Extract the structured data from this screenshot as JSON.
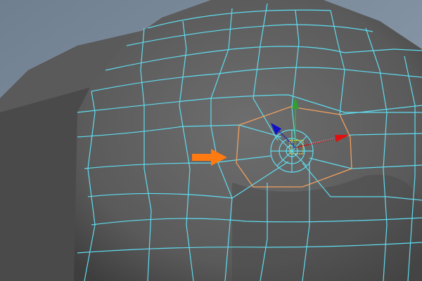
{
  "viewport": {
    "background_color": "#7c8c9c",
    "mesh_color": "#5fdcf0",
    "selection_color": "#f0a060",
    "annotation_arrow_color": "#ff7a10",
    "gizmo": {
      "x_color": "#e01010",
      "y_color": "#20c020",
      "z_color": "#1010c0"
    }
  }
}
